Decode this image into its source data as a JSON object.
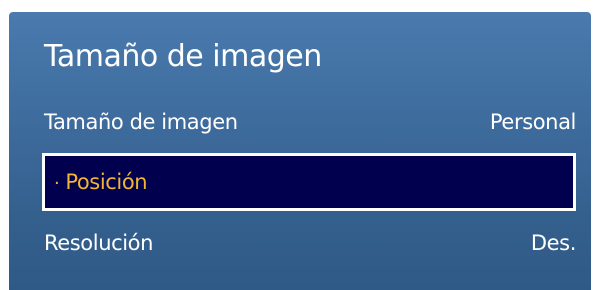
{
  "menu": {
    "title": "Tamaño de imagen",
    "items": [
      {
        "label": "Tamaño de imagen",
        "value": "Personal"
      },
      {
        "label": "Posición",
        "bullet": "·",
        "value": ""
      },
      {
        "label": "Resolución",
        "value": "Des."
      }
    ],
    "selected_index": 1
  },
  "colors": {
    "panel_top": "#4a7aae",
    "panel_bottom": "#2f5987",
    "highlight_bg": "#00004e",
    "highlight_text": "#f2b531",
    "text": "#ffffff"
  }
}
